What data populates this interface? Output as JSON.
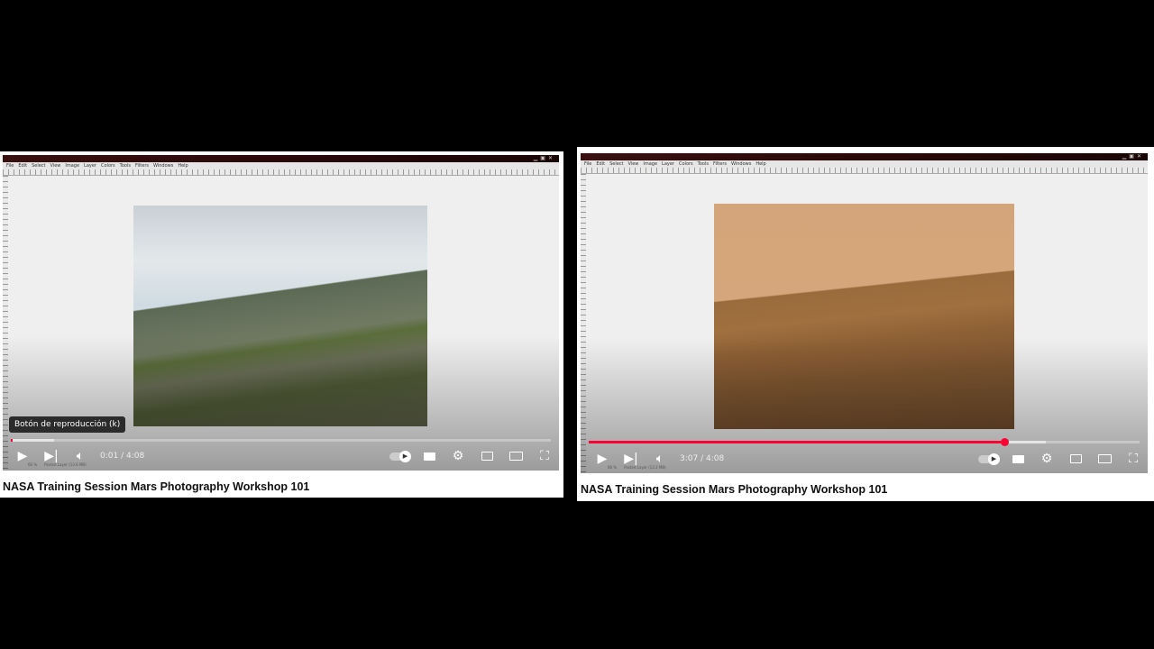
{
  "players": [
    {
      "gimp_menu": [
        "File",
        "Edit",
        "Select",
        "View",
        "Image",
        "Layer",
        "Colors",
        "Tools",
        "Filters",
        "Windows",
        "Help"
      ],
      "status_text": "Pasted Layer (13.6 MB)",
      "zoom_text": "66 %",
      "current_time": "0:01",
      "duration": "4:08",
      "time_display": "0:01 / 4:08",
      "progress_fraction": 0.004,
      "tooltip": "Botón de reproducción (k)",
      "title": "NASA Training Session Mars Photography Workshop 101"
    },
    {
      "gimp_menu": [
        "File",
        "Edit",
        "Select",
        "View",
        "Image",
        "Layer",
        "Colors",
        "Tools",
        "Filters",
        "Windows",
        "Help"
      ],
      "status_text": "Pasted Layer (13.2 MB)",
      "zoom_text": "66 %",
      "current_time": "3:07",
      "duration": "4:08",
      "time_display": "3:07 / 4:08",
      "progress_fraction": 0.754,
      "buffered_fraction": 0.83,
      "title": "NASA Training Session Mars Photography Workshop 101"
    }
  ],
  "colors": {
    "progress": "#ff0033"
  }
}
